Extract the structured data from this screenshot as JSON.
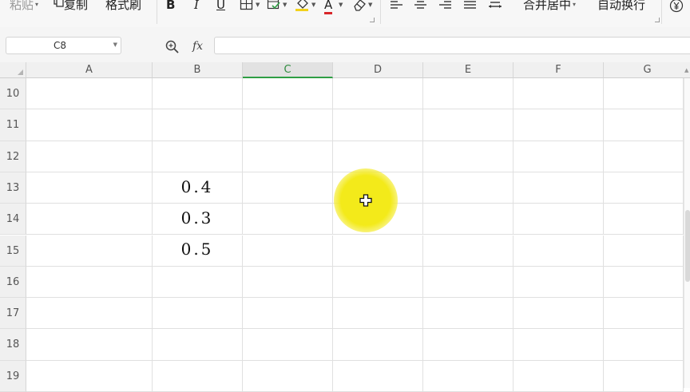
{
  "ribbon": {
    "paste_label": "粘贴",
    "copy_label": "复制",
    "format_painter_label": "格式刷",
    "bold_label": "B",
    "italic_label": "I",
    "underline_label": "U",
    "font_color_label": "A",
    "merge_center_label": "合并居中",
    "wrap_text_label": "自动换行",
    "accent_red": "#d8262a",
    "accent_yellow": "#f2d11b"
  },
  "formula_bar": {
    "name_box_value": "C8",
    "fx_label": "fx",
    "formula_value": ""
  },
  "grid": {
    "columns": [
      "A",
      "B",
      "C",
      "D",
      "E",
      "F",
      "G"
    ],
    "active_column": "C",
    "rows": [
      {
        "num": "10",
        "b": ""
      },
      {
        "num": "11",
        "b": ""
      },
      {
        "num": "12",
        "b": ""
      },
      {
        "num": "13",
        "b": "0.4"
      },
      {
        "num": "14",
        "b": "0.3"
      },
      {
        "num": "15",
        "b": "0.5"
      },
      {
        "num": "16",
        "b": ""
      },
      {
        "num": "17",
        "b": ""
      },
      {
        "num": "18",
        "b": ""
      },
      {
        "num": "19",
        "b": ""
      }
    ]
  },
  "cursor": {
    "icon": "crosshair-icon",
    "highlight_color": "#f3ea1a"
  }
}
